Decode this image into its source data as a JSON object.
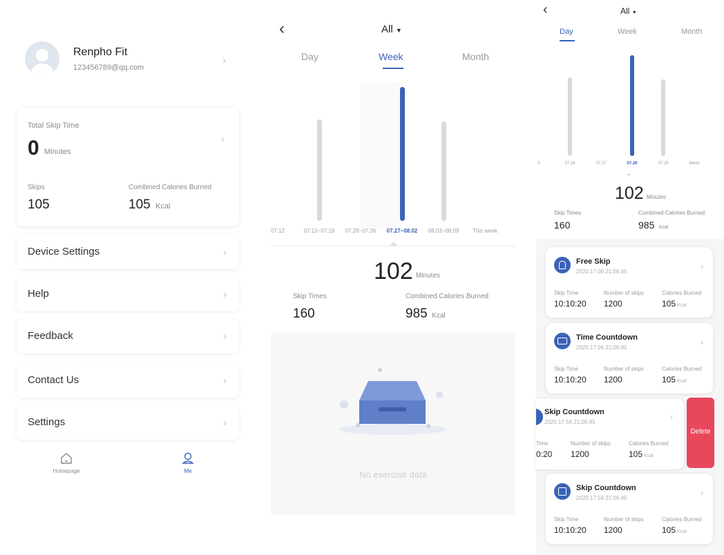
{
  "profile": {
    "name": "Renpho Fit",
    "email": "123456789@qq.com"
  },
  "summary": {
    "total_label": "Total Skip Time",
    "total_value": "0",
    "total_unit": "Minutes",
    "skips_label": "Skips",
    "skips_value": "105",
    "calories_label": "Combined Calories Burned",
    "calories_value": "105",
    "calories_unit": "Kcal"
  },
  "menu": [
    {
      "label": "Device Settings"
    },
    {
      "label": "Help"
    },
    {
      "label": "Feedback"
    },
    {
      "label": "Contact Us"
    },
    {
      "label": "Settings"
    }
  ],
  "bottom_nav": {
    "home": "Homepage",
    "me": "Me"
  },
  "week_screen": {
    "filter": "All",
    "tabs": [
      "Day",
      "Week",
      "Month"
    ],
    "active_tab": "Week",
    "minutes_value": "102",
    "minutes_unit": "Minutes",
    "times_label": "Skip Times",
    "times_value": "160",
    "calories_label": "Combined Calories Burned",
    "calories_value": "985",
    "calories_unit": "Kcal",
    "empty_text": "No exercise data"
  },
  "day_screen": {
    "filter": "All",
    "tabs": [
      "Day",
      "Week",
      "Month"
    ],
    "active_tab": "Day",
    "minutes_value": "102",
    "minutes_unit": "Minutes",
    "times_label": "Skip Times",
    "times_value": "160",
    "calories_label": "Combined Calories Burned",
    "calories_value": "985",
    "calories_unit": "Kcal",
    "delete_label": "Delete",
    "record_labels": {
      "time": "Skip Time",
      "count": "Number of skips",
      "calories": "Calories Burned",
      "unit": "Kcal"
    },
    "records": [
      {
        "title": "Free Skip",
        "date": "2020.17.06 21:06:45",
        "time": "10:10:20",
        "count": "1200",
        "calories": "105"
      },
      {
        "title": "Time Countdown",
        "date": "2020.17.06 21:06:45",
        "time": "10:10:20",
        "count": "1200",
        "calories": "105"
      },
      {
        "title": "Skip Countdown",
        "date": "2020.17.56 21:06:45",
        "time": "0:20",
        "time_label": "Time",
        "count": "1200",
        "calories": "105"
      },
      {
        "title": "Skip Countdown",
        "date": "2020.17.56 21:06:45",
        "time": "10:10:20",
        "count": "1200",
        "calories": "105"
      }
    ]
  },
  "chart_data": [
    {
      "type": "bar",
      "categories": [
        "07.12",
        "07.13~07.19",
        "07.20~07.26",
        "07.27~08.02",
        "08.03~08.09",
        "This week"
      ],
      "values": [
        0,
        0.76,
        0,
        1.0,
        0.74,
        0
      ],
      "active_category": "07.27~08.02",
      "title": "",
      "xlabel": "",
      "ylabel": "",
      "grid": false
    },
    {
      "type": "bar",
      "categories": [
        "0",
        "07.26",
        "07.27",
        "07.28",
        "07.29",
        "Week"
      ],
      "values": [
        0,
        0.78,
        0,
        1.0,
        0.76,
        0
      ],
      "active_category": "07.28",
      "title": "",
      "xlabel": "",
      "ylabel": "",
      "grid": false
    }
  ],
  "colors": {
    "accent": "#3a62b8",
    "inactive_bar": "#d9d9d9",
    "delete": "#e8475c"
  }
}
